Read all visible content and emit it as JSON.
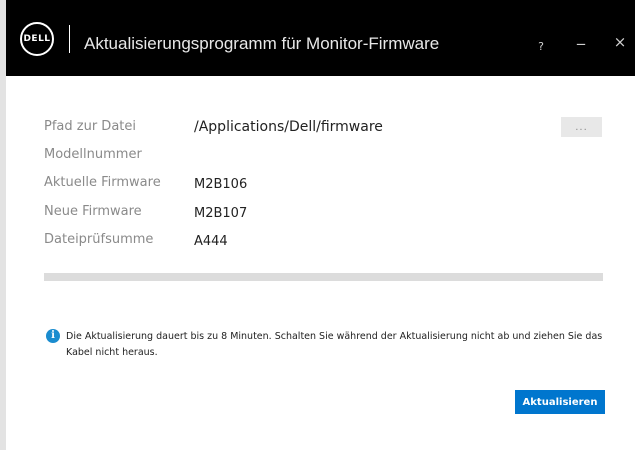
{
  "titlebar": {
    "logo_text": "DELL",
    "title": "Aktualisierungsprogramm für Monitor-Firmware",
    "help_label": "?",
    "minimize_label": "_",
    "close_label": "×"
  },
  "fields": {
    "file_path": {
      "label": "Pfad zur Datei",
      "value": "/Applications/Dell/firmware"
    },
    "model_number": {
      "label": "Modellnummer",
      "value": ""
    },
    "current_firmware": {
      "label": "Aktuelle Firmware",
      "value": "M2B106"
    },
    "new_firmware": {
      "label": "Neue Firmware",
      "value": "M2B107"
    },
    "checksum": {
      "label": "Dateiprüfsumme",
      "value": "A444"
    }
  },
  "browse_button": {
    "label": "..."
  },
  "progress": {
    "value": 0
  },
  "info": {
    "icon": "info-icon",
    "icon_glyph": "i",
    "text": "Die Aktualisierung dauert bis zu 8 Minuten. Schalten Sie während der Aktualisierung nicht ab und ziehen Sie das Kabel nicht heraus."
  },
  "actions": {
    "update_label": "Aktualisieren"
  },
  "colors": {
    "accent": "#0076ce",
    "titlebar": "#000000",
    "info_icon": "#1a8ccf"
  }
}
